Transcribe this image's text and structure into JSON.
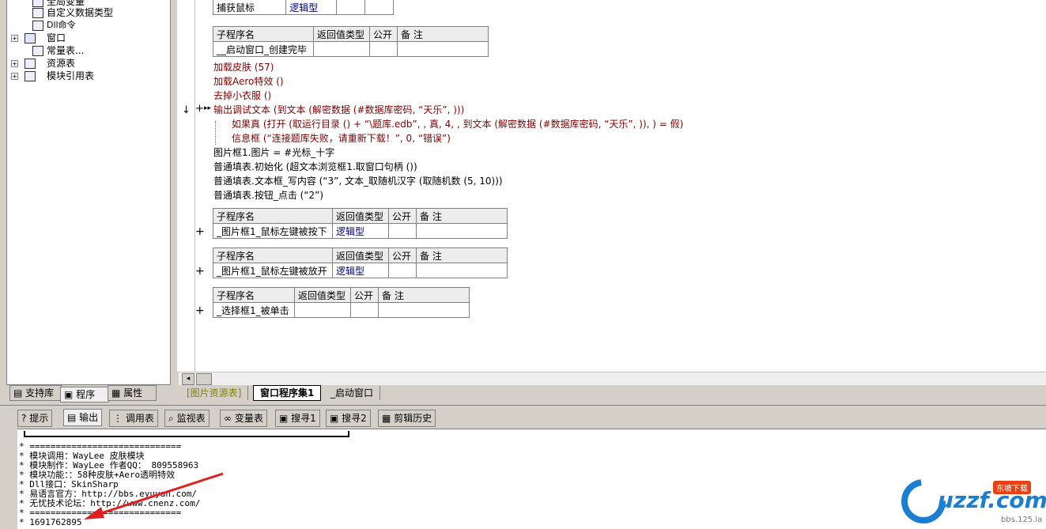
{
  "tree": {
    "items": [
      {
        "label": "全局变量"
      },
      {
        "label": "自定义数据类型"
      },
      {
        "label": "Dll命令"
      },
      {
        "label": "窗口"
      },
      {
        "label": "常量表..."
      },
      {
        "label": "资源表"
      },
      {
        "label": "模块引用表"
      }
    ]
  },
  "left_tabs": [
    "支持库",
    "程序",
    "属性"
  ],
  "editor": {
    "top_table": {
      "name": "捕获鼠标",
      "ret": "逻辑型"
    },
    "table_headers": [
      "子程序名",
      "返回值类型",
      "公开",
      "备 注"
    ],
    "sub1": {
      "name": "__启动窗口_创建完毕",
      "ret": ""
    },
    "lines": [
      "加载皮肤 (57)",
      "加载Aero特效 ()",
      "去掉小衣服 ()",
      "输出调试文本 (到文本 (解密数据 (#数据库密码, “天乐”, )))",
      "如果真 (打开 (取运行目录 () + “\\题库.edb”, , 真, 4, , 到文本 (解密数据 (#数据库密码, “天乐”, )), ) = 假)",
      "信息框 (“连接题库失败，请重新下载！”, 0, “错误”)",
      "图片框1.图片 = #光标_十字",
      "普通填表.初始化 (超文本浏览框1.取窗口句柄 ())",
      "普通填表.文本框_写内容 (“3”, 文本_取随机汉字 (取随机数 (5, 10)))",
      "普通填表.按钮_点击 (“2”)"
    ],
    "sub2": {
      "name": "_图片框1_鼠标左键被按下",
      "ret": "逻辑型"
    },
    "sub3": {
      "name": "_图片框1_鼠标左键被放开",
      "ret": "逻辑型"
    },
    "sub4": {
      "name": "_选择框1_被单击",
      "ret": ""
    }
  },
  "editor_tabs": [
    "[图片资源表]",
    "窗口程序集1",
    "_启动窗口"
  ],
  "bottom_tabs": [
    "提示",
    "输出",
    "调用表",
    "监视表",
    "变量表",
    "搜寻1",
    "搜寻2",
    "剪辑历史"
  ],
  "output_lines": [
    "* =============================",
    "* 模块调用：WayLee 皮肤模块",
    "* 模块制作：WayLee 作者QQ： 809558963",
    "* 模块功能：：58种皮肤+Aero透明特效",
    "* Dll接口：SkinSharp",
    "* 易语言官方：http://bbs.eyuyan.com/",
    "* 无忧技术论坛：http://www.cnenz.com/",
    "* =============================",
    "* 1691762895"
  ],
  "watermark": {
    "brand": "uzzf.com",
    "sub": "bbs.125.la",
    "badge": "东坡下载"
  },
  "colors": {
    "keyword": "#800000",
    "string": "#000080",
    "accent_arrow": "#e02020"
  }
}
